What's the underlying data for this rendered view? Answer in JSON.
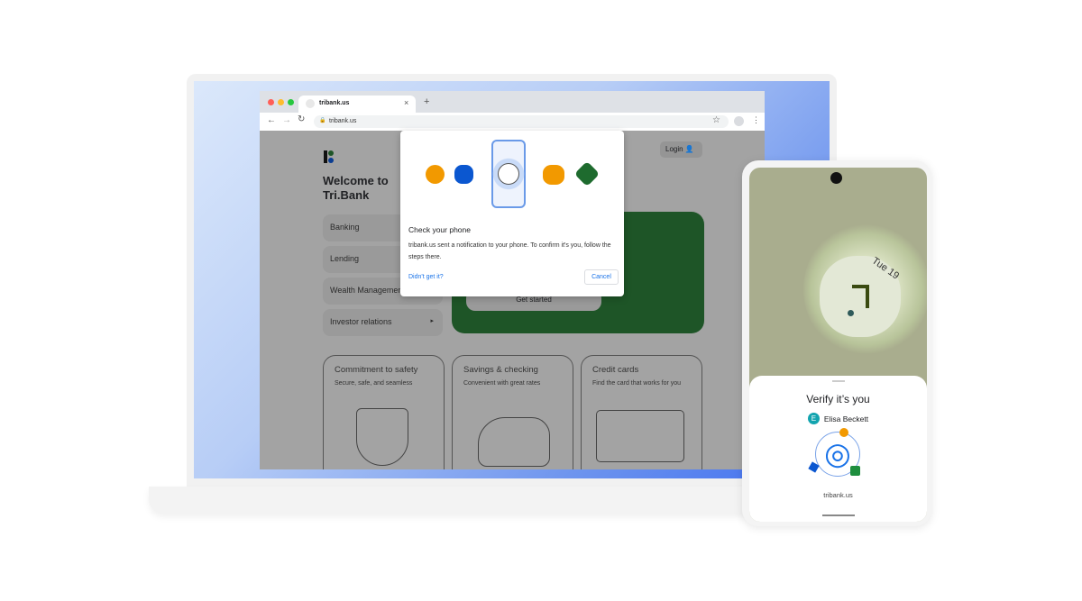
{
  "browser": {
    "tab_title": "tribank.us",
    "url": "tribank.us",
    "new_tab": "+",
    "close_tab": "×"
  },
  "page": {
    "welcome_line1": "Welcome to",
    "welcome_line2": "Tri.Bank",
    "login": "Login",
    "nav": [
      {
        "label": "Banking"
      },
      {
        "label": "Lending"
      },
      {
        "label": "Wealth Management"
      },
      {
        "label": "Investor relations"
      }
    ],
    "get_started": "Get started",
    "cards": [
      {
        "title": "Commitment to safety",
        "subtitle": "Secure, safe, and seamless"
      },
      {
        "title": "Savings & checking",
        "subtitle": "Convenient with great rates"
      },
      {
        "title": "Credit cards",
        "subtitle": "Find the card that works for you"
      }
    ]
  },
  "dialog": {
    "title": "Check your phone",
    "body": "tribank.us sent a notification to your phone. To confirm it's you, follow the steps there.",
    "didnt_get": "Didn't get it?",
    "cancel": "Cancel"
  },
  "phone": {
    "date": "Tue 19",
    "sheet_title": "Verify it’s you",
    "account_initial": "E",
    "account_name": "Elisa Beckett",
    "site": "tribank.us"
  },
  "colors": {
    "accent": "#1a73e8",
    "green": "#1e6b2e",
    "yellow": "#f29900",
    "blue": "#0b57d0"
  }
}
